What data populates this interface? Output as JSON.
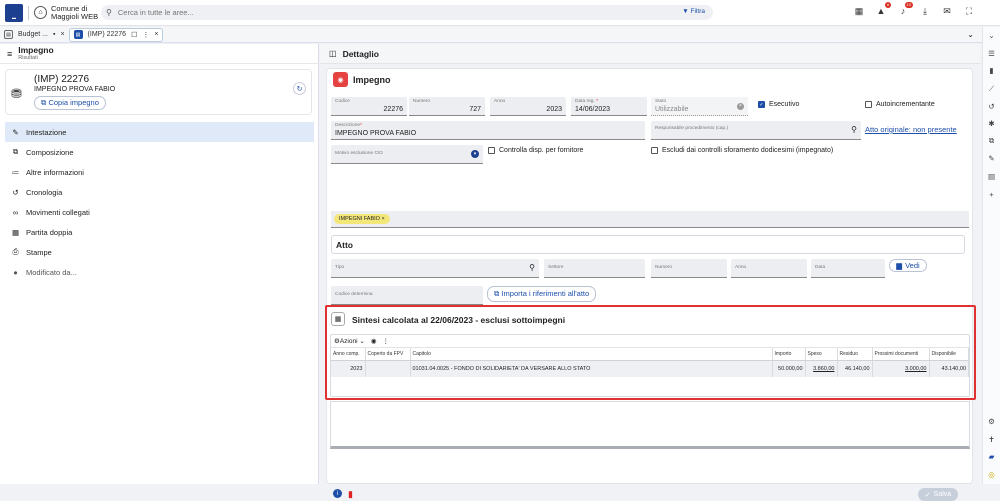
{
  "header": {
    "app_name": "Comune di Maggioli WEB",
    "search_placeholder": "Cerca in tutte le aree...",
    "filter_label": "Filtra",
    "alerts_badge": "6",
    "notifications_badge": "10"
  },
  "tabs": [
    {
      "label": "Budget ..."
    },
    {
      "label": "(IMP) 22276"
    }
  ],
  "left": {
    "title": "Impegno",
    "subtitle": "Risultati",
    "card": {
      "code": "(IMP) 22276",
      "name": "IMPEGNO PROVA FABIO",
      "copy_label": "Copia impegno"
    },
    "nav": [
      {
        "label": "Intestazione",
        "icon": "pencil-icon"
      },
      {
        "label": "Composizione",
        "icon": "copy-icon"
      },
      {
        "label": "Altre informazioni",
        "icon": "list-icon"
      },
      {
        "label": "Cronologia",
        "icon": "history-icon"
      },
      {
        "label": "Movimenti collegati",
        "icon": "link-icon"
      },
      {
        "label": "Partita doppia",
        "icon": "calc-icon"
      },
      {
        "label": "Stampe",
        "icon": "print-icon"
      },
      {
        "label": "Modificato da...",
        "icon": "user-icon"
      }
    ]
  },
  "detail": {
    "header": "Dettaglio",
    "section_title": "Impegno",
    "fields": {
      "codice_label": "Codice",
      "codice_value": "22276",
      "numero_label": "Numero",
      "numero_value": "727",
      "anno_label": "Anno",
      "anno_value": "2023",
      "data_reg_label": "Data reg.",
      "data_reg_value": "14/06/2023",
      "stato_label": "Stato",
      "stato_value": "Utilizzabile",
      "descrizione_label": "Descrizione",
      "descrizione_value": "IMPEGNO PROVA FABIO",
      "responsabile_label": "Responsabile procedimento (cap.)",
      "motivo_label": "Motivo esclusione CIG"
    },
    "checkboxes": {
      "esecutivo": "Esecutivo",
      "autoincrementante": "Autoincrementante",
      "controlla": "Controlla disp. per fornitore",
      "escludi": "Escludi dai controlli sforamento dodicesimi (impegnato)"
    },
    "atto_originale": "Atto originale: non presente",
    "chip": "IMPEGNI FABIO",
    "atto": {
      "title": "Atto",
      "tipo_label": "Tipo",
      "settore_label": "Settore",
      "numero_label": "Numero",
      "anno_label": "Anno",
      "data_label": "Data",
      "vedi_label": "Vedi",
      "codice_determina_label": "Codice determina",
      "importa_label": "Importa i riferimenti all'atto"
    },
    "sintesi": {
      "title": "Sintesi calcolata al 22/06/2023 - esclusi sottoimpegni",
      "azioni_label": "Azioni",
      "columns": [
        "Anno comp.",
        "Coperto da FPV",
        "Capitolo",
        "Importo",
        "Speso",
        "Residuo",
        "Prossimi documenti",
        "Disponibile"
      ],
      "rows": [
        [
          "2023",
          "",
          "01031.04.0025 - FONDO DI SOLIDARIETA' DA VERSARE ALLO STATO",
          "50.000,00",
          "3.860,00",
          "46.140,00",
          "3.000,00",
          "43.140,00"
        ]
      ]
    },
    "salva_label": "Salva"
  },
  "colors": {
    "accent": "#1d4fa8",
    "danger": "#e03131",
    "chip": "#f3e77a"
  }
}
